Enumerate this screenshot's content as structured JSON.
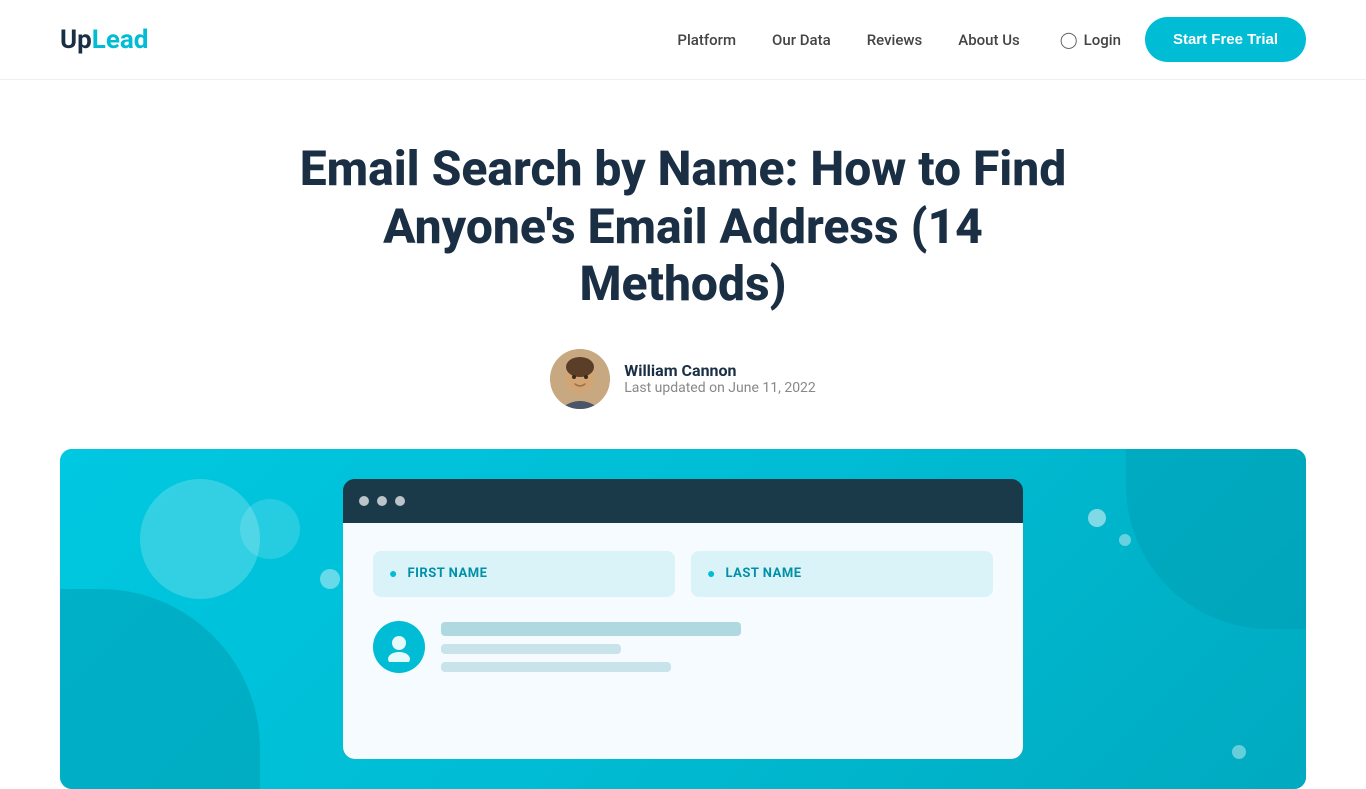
{
  "brand": {
    "logo_up": "Up",
    "logo_lead": "Lead"
  },
  "nav": {
    "links": [
      {
        "id": "platform",
        "label": "Platform"
      },
      {
        "id": "our-data",
        "label": "Our Data"
      },
      {
        "id": "reviews",
        "label": "Reviews"
      },
      {
        "id": "about-us",
        "label": "About Us"
      }
    ],
    "login_label": "Login",
    "trial_label": "Start Free Trial"
  },
  "hero": {
    "title": "Email Search by Name: How to Find Anyone's Email Address (14 Methods)",
    "author_name": "William Cannon",
    "author_date": "Last updated on June 11, 2022"
  },
  "illustration": {
    "first_name_label": "FIRST NAME",
    "last_name_label": "LAST NAME"
  },
  "colors": {
    "accent": "#00bcd4",
    "dark": "#1a2e44",
    "logo_teal": "#00bcd4"
  }
}
